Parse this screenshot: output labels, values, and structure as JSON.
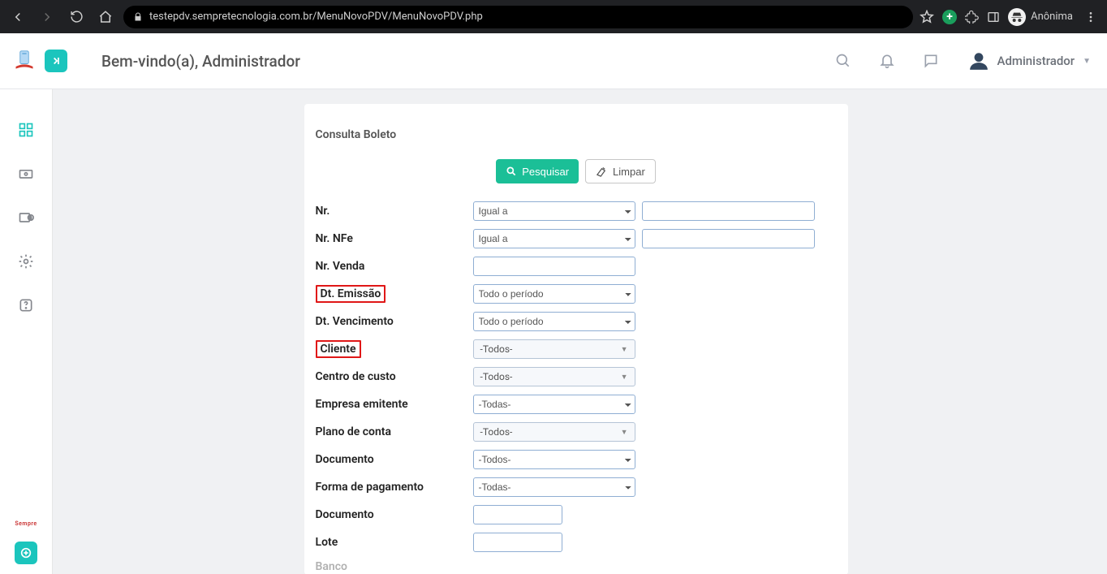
{
  "browser": {
    "url": "testepdv.sempretecnologia.com.br/MenuNovoPDV/MenuNovoPDV.php",
    "profile": "Anônima"
  },
  "header": {
    "welcome": "Bem-vindo(a), Administrador",
    "user_name": "Administrador"
  },
  "card": {
    "title": "Consulta Boleto",
    "buttons": {
      "search": "Pesquisar",
      "clear": "Limpar"
    }
  },
  "labels": {
    "nr": "Nr.",
    "nr_nfe": "Nr. NFe",
    "nr_venda": "Nr. Venda",
    "dt_emissao": "Dt. Emissão",
    "dt_vencimento": "Dt. Vencimento",
    "cliente": "Cliente",
    "centro_custo": "Centro de custo",
    "empresa_emitente": "Empresa emitente",
    "plano_conta": "Plano de conta",
    "documento": "Documento",
    "forma_pagamento": "Forma de pagamento",
    "documento2": "Documento",
    "lote": "Lote",
    "banco": "Banco"
  },
  "selects": {
    "igual_a": "Igual a",
    "todo_periodo": "Todo o período",
    "todos": "-Todos-",
    "todas": "-Todas-"
  }
}
